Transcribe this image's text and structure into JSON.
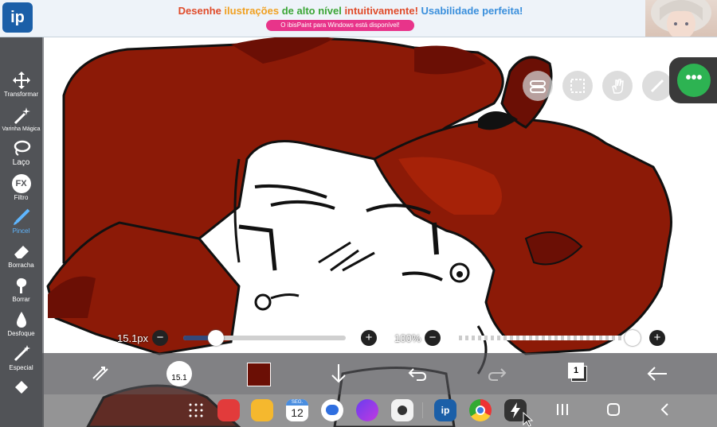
{
  "banner": {
    "headline_parts": [
      "Desenhe ",
      "ilustrações",
      " de alto nível",
      " intuitivamente!",
      " Usabilidade perfeita!"
    ],
    "pill_text": "O ibisPaint para Windows está disponível!",
    "logo_text": "ip"
  },
  "tools": [
    {
      "label": "Transformar",
      "icon": "move-arrows-icon"
    },
    {
      "label": "Varinha Mágica",
      "icon": "magic-wand-icon"
    },
    {
      "label": "Laço",
      "icon": "lasso-icon"
    },
    {
      "label": "Filtro",
      "icon": "fx-icon",
      "glyph": "FX"
    },
    {
      "label": "Pincel",
      "icon": "brush-icon",
      "active": true
    },
    {
      "label": "Borracha",
      "icon": "eraser-icon"
    },
    {
      "label": "Borrar",
      "icon": "smudge-icon"
    },
    {
      "label": "Desfoque",
      "icon": "blur-drop-icon"
    },
    {
      "label": "Especial",
      "icon": "special-pen-icon"
    }
  ],
  "sliders": {
    "brush_size_label": "15.1px",
    "opacity_label": "100%",
    "brush_size_fraction": 0.2,
    "opacity_fraction": 1.0,
    "minus": "−",
    "plus": "+"
  },
  "bottombar": {
    "brush_preview_label": "15.1",
    "layer_count": "1",
    "current_color": "#6b0f05"
  },
  "dock": {
    "calendar_day": "12",
    "calendar_weekday": "SEG."
  },
  "colors": {
    "hair_dark": "#6b0f05",
    "hair_mid": "#8c1a07",
    "hair_bright": "#a62208",
    "menu_green": "#2db352",
    "active_tool": "#5fb6ff"
  }
}
